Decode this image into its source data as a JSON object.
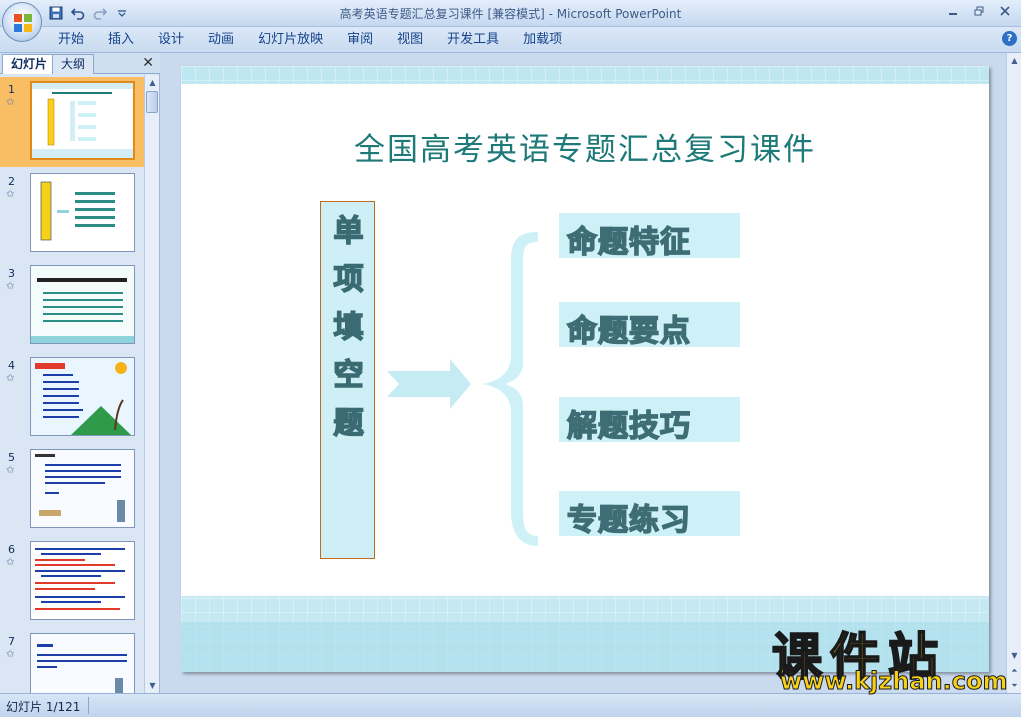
{
  "window": {
    "title": "高考英语专题汇总复习课件 [兼容模式] - Microsoft PowerPoint"
  },
  "quick_access": {
    "icons": [
      "save-icon",
      "undo-icon",
      "redo-icon",
      "customize-icon"
    ]
  },
  "ribbon": {
    "tabs": [
      "开始",
      "插入",
      "设计",
      "动画",
      "幻灯片放映",
      "审阅",
      "视图",
      "开发工具",
      "加载项"
    ]
  },
  "left_panel": {
    "tab_slides": "幻灯片",
    "tab_outline": "大纲",
    "slide_numbers": [
      "1",
      "2",
      "3",
      "4",
      "5",
      "6",
      "7"
    ],
    "selected_slide": "1"
  },
  "slide": {
    "title": "全国高考英语专题汇总复习课件",
    "vertical_label": [
      "单",
      "项",
      "填",
      "空",
      "题"
    ],
    "topics": [
      "命题特征",
      "命题要点",
      "解题技巧",
      "专题练习"
    ]
  },
  "watermark": {
    "title": "课件站",
    "url": "www.kjzhan.com"
  },
  "status_bar": {
    "slide_info": "幻灯片 1/121"
  },
  "colors": {
    "title_text": "#1d7a78",
    "topic_box": "#cdf1f7",
    "vertical_box_border": "#c06a1a",
    "selected_thumb": "#f9be63",
    "watermark": "#f7d117"
  }
}
